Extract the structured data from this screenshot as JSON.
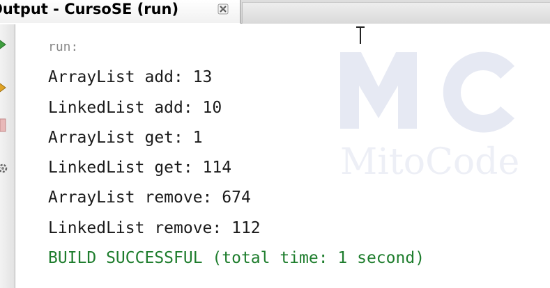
{
  "tab": {
    "title": "Output - CursoSE (run)"
  },
  "toolbar": {
    "buttons": [
      {
        "icon": "rerun-icon"
      },
      {
        "icon": "run-again-icon"
      },
      {
        "icon": "stop-icon"
      },
      {
        "icon": "settings-icon"
      }
    ]
  },
  "console": {
    "lines": [
      {
        "text": "run:",
        "kind": "info"
      },
      {
        "text": "ArrayList add: 13",
        "kind": "output"
      },
      {
        "text": "LinkedList add: 10",
        "kind": "output"
      },
      {
        "text": "ArrayList get: 1",
        "kind": "output"
      },
      {
        "text": "LinkedList get: 114",
        "kind": "output"
      },
      {
        "text": "ArrayList remove: 674",
        "kind": "output"
      },
      {
        "text": "LinkedList remove: 112",
        "kind": "output"
      },
      {
        "text": "BUILD SUCCESSFUL (total time: 1 second)",
        "kind": "success"
      }
    ]
  },
  "watermark": {
    "text": "MitoCode",
    "monogram": "MC"
  },
  "colors": {
    "success": "#1e7d2d",
    "run": "#8a8a8a",
    "text": "#1a1a1a",
    "watermark": "#e6e9f3"
  }
}
